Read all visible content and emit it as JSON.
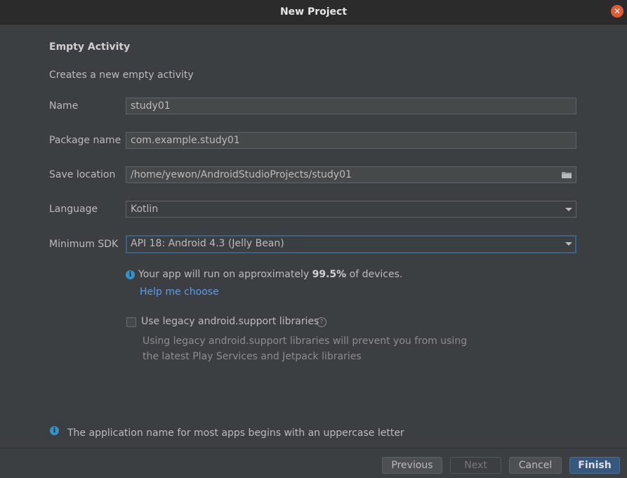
{
  "window": {
    "title": "New Project"
  },
  "form": {
    "heading": "Empty Activity",
    "description": "Creates a new empty activity",
    "name": {
      "label": "Name",
      "value": "study01"
    },
    "package_name": {
      "label": "Package name",
      "value": "com.example.study01"
    },
    "save_location": {
      "label": "Save location",
      "value": "/home/yewon/AndroidStudioProjects/study01"
    },
    "language": {
      "label": "Language",
      "value": "Kotlin"
    },
    "minimum_sdk": {
      "label": "Minimum SDK",
      "value": "API 18: Android 4.3 (Jelly Bean)"
    }
  },
  "sdk_info": {
    "prefix": "Your app will run on approximately ",
    "percent": "99.5%",
    "suffix": " of devices.",
    "help_link": "Help me choose"
  },
  "legacy": {
    "label": "Use legacy android.support libraries",
    "checked": false,
    "desc_line1": "Using legacy android.support libraries will prevent you from using",
    "desc_line2": "the latest Play Services and Jetpack libraries"
  },
  "bottom_info": "The application name for most apps begins with an uppercase letter",
  "buttons": {
    "previous": "Previous",
    "next": "Next",
    "cancel": "Cancel",
    "finish": "Finish"
  },
  "colors": {
    "background": "#3c3f41",
    "accent": "#365880",
    "link": "#589df6",
    "info": "#3592c4",
    "close": "#e05a35"
  }
}
